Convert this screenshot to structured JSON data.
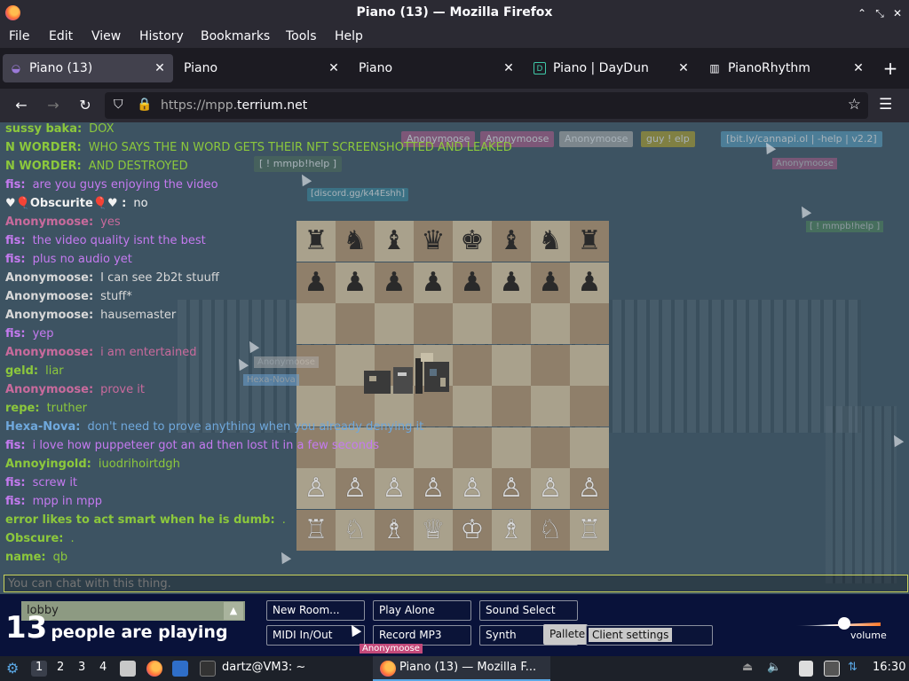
{
  "window": {
    "title": "Piano (13) — Mozilla Firefox"
  },
  "menu": [
    "File",
    "Edit",
    "View",
    "History",
    "Bookmarks",
    "Tools",
    "Help"
  ],
  "tabs": [
    {
      "label": "Piano (13)",
      "active": true
    },
    {
      "label": "Piano",
      "active": false
    },
    {
      "label": "Piano",
      "active": false
    },
    {
      "label": "Piano | DayDun",
      "active": false
    },
    {
      "label": "PianoRhythm",
      "active": false
    }
  ],
  "url": {
    "scheme": "https://mpp.",
    "host": "terrium.net"
  },
  "top_tags": [
    {
      "label": "Anonymoose",
      "bg": "#b35b8b"
    },
    {
      "label": "Anonymoose",
      "bg": "#b35b8b"
    },
    {
      "label": "Anonymoose",
      "bg": "#b0b0b0"
    },
    {
      "label": "guy ! elp",
      "bg": "#b7a52a"
    },
    {
      "label": "[bit.ly/cannapi.ol | -help | v2.2]",
      "bg": "#5aa1c4"
    },
    {
      "label": "[ ! mmpb!help ]",
      "bg": "#4f6d5a"
    },
    {
      "label": "[discord.gg/k44Eshh]",
      "bg": "#3a8aa0"
    }
  ],
  "chat": [
    {
      "who": "sussy baka:",
      "msg": "DOX",
      "color": "#8cc83c"
    },
    {
      "who": "N WORDER:",
      "msg": "WHO SAYS THE N WORD GETS THEIR NFT SCREENSHOTTED AND LEAKED",
      "color": "#8cc83c"
    },
    {
      "who": "N WORDER:",
      "msg": "AND DESTROYED",
      "color": "#8cc83c"
    },
    {
      "who": "fis:",
      "msg": "are you guys enjoying the video",
      "color": "#c57af0"
    },
    {
      "who": "♥🎈Obscurite🎈♥ :",
      "msg": "no",
      "color": "#f1f1f1"
    },
    {
      "who": "Anonymoose:",
      "msg": "yes",
      "color": "#c96a9c"
    },
    {
      "who": "fis:",
      "msg": "the video quality isnt the best",
      "color": "#c57af0"
    },
    {
      "who": "fis:",
      "msg": "plus no audio yet",
      "color": "#c57af0"
    },
    {
      "who": "Anonymoose:",
      "msg": "I can see 2b2t stuuff",
      "color": "#d8d8d8"
    },
    {
      "who": "Anonymoose:",
      "msg": "stuff*",
      "color": "#d8d8d8"
    },
    {
      "who": "Anonymoose:",
      "msg": "hausemaster",
      "color": "#d8d8d8"
    },
    {
      "who": "fis:",
      "msg": "yep",
      "color": "#c57af0"
    },
    {
      "who": "Anonymoose:",
      "msg": "i am entertained",
      "color": "#c96a9c"
    },
    {
      "who": "geld:",
      "msg": "liar",
      "color": "#8cc83c"
    },
    {
      "who": "Anonymoose:",
      "msg": "prove it",
      "color": "#c96a9c"
    },
    {
      "who": "repe:",
      "msg": "truther",
      "color": "#8cc83c"
    },
    {
      "who": "Hexa-Nova:",
      "msg": "don't need to prove anything when you already denying it",
      "color": "#6fa8dc"
    },
    {
      "who": "fis:",
      "msg": "i love how puppeteer got an ad then lost it in a few seconds",
      "color": "#c57af0"
    },
    {
      "who": "Annoyingold:",
      "msg": "iuodrihoirtdgh",
      "color": "#8cc83c"
    },
    {
      "who": "fis:",
      "msg": "screw it",
      "color": "#c57af0"
    },
    {
      "who": "fis:",
      "msg": "mpp in mpp",
      "color": "#c57af0"
    },
    {
      "who": "error likes to act smart when he is dumb:",
      "msg": ".",
      "color": "#8cc83c"
    },
    {
      "who": "Obscure:",
      "msg": ".",
      "color": "#8cc83c"
    },
    {
      "who": "name:",
      "msg": "qb",
      "color": "#8cc83c"
    }
  ],
  "cursor_labels": [
    "Anonymoose",
    "Hexa-Nova",
    "Anonymoose",
    "[ ! mmpb!help ]"
  ],
  "chat_input": {
    "placeholder": "You can chat with this thing."
  },
  "room": {
    "name": "lobby"
  },
  "people": {
    "count": "13",
    "text": "people are playing"
  },
  "buttons": {
    "new_room": "New Room...",
    "play_alone": "Play Alone",
    "sound_select": "Sound Select",
    "midi": "MIDI In/Out",
    "record": "Record MP3",
    "synth": "Synth",
    "pallete": "Pallete",
    "client_settings": "Client settings"
  },
  "anon_label": "Anonymoose",
  "volume": {
    "label": "volume",
    "level": 0.55
  },
  "taskbar": {
    "workspaces": [
      "1",
      "2",
      "3",
      "4"
    ],
    "terminal": "dartz@VM3: ~",
    "firefox": "Piano (13) — Mozilla F...",
    "clock": "16:30"
  }
}
